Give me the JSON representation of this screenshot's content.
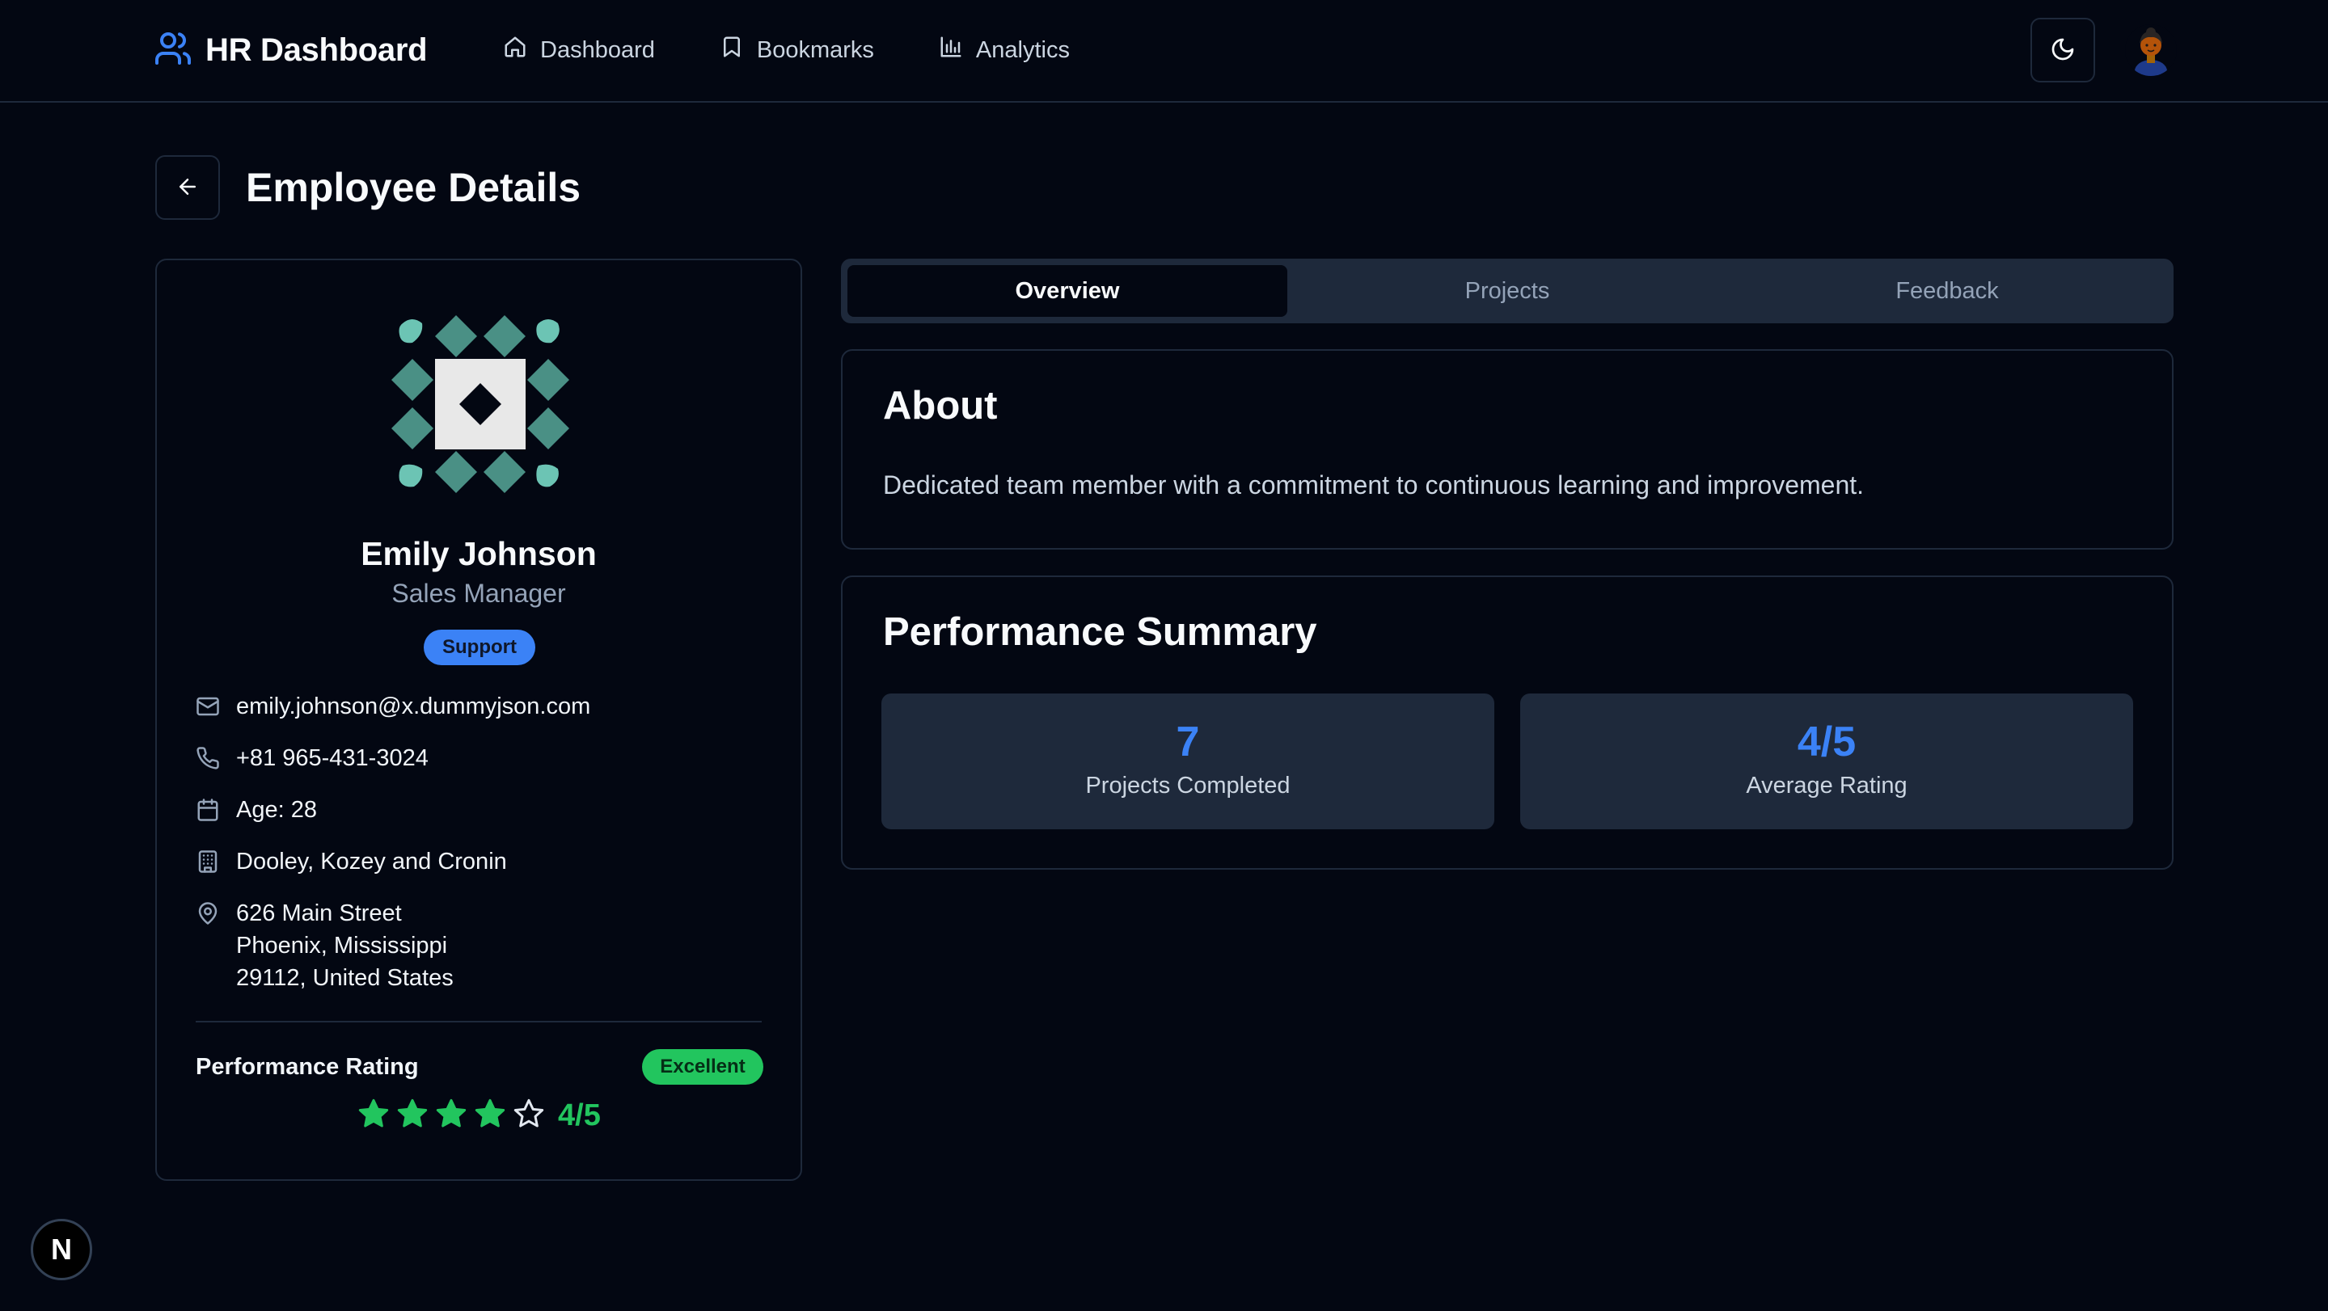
{
  "app": {
    "brand": "HR Dashboard",
    "nav": [
      {
        "label": "Dashboard",
        "icon": "home-icon"
      },
      {
        "label": "Bookmarks",
        "icon": "bookmark-icon"
      },
      {
        "label": "Analytics",
        "icon": "bar-chart-icon"
      }
    ],
    "theme_toggle_icon": "moon-icon",
    "avatar_icon": "user-avatar"
  },
  "page": {
    "title": "Employee Details",
    "back_icon": "arrow-left-icon"
  },
  "employee": {
    "name": "Emily Johnson",
    "title": "Sales Manager",
    "department": "Support",
    "email": "emily.johnson@x.dummyjson.com",
    "phone": "+81 965-431-3024",
    "age": "Age: 28",
    "company": "Dooley, Kozey and Cronin",
    "address": {
      "line1": "626 Main Street",
      "line2": "Phoenix, Mississippi",
      "line3": "29112, United States"
    },
    "performance_label": "Performance Rating",
    "performance_badge": "Excellent",
    "rating": 4,
    "rating_max": 5,
    "rating_text": "4/5"
  },
  "tabs": [
    {
      "label": "Overview",
      "active": true
    },
    {
      "label": "Projects",
      "active": false
    },
    {
      "label": "Feedback",
      "active": false
    }
  ],
  "about": {
    "title": "About",
    "text": "Dedicated team member with a commitment to continuous learning and improvement."
  },
  "performance_summary": {
    "title": "Performance Summary",
    "stats": [
      {
        "value": "7",
        "label": "Projects Completed"
      },
      {
        "value": "4/5",
        "label": "Average Rating"
      }
    ]
  },
  "dev_badge": "N",
  "colors": {
    "background": "#030712",
    "border": "#1e293b",
    "accent_blue": "#3b82f6",
    "accent_green": "#22c55e",
    "identicon_teal": "#4a9085",
    "identicon_light": "#e8e8e8"
  }
}
